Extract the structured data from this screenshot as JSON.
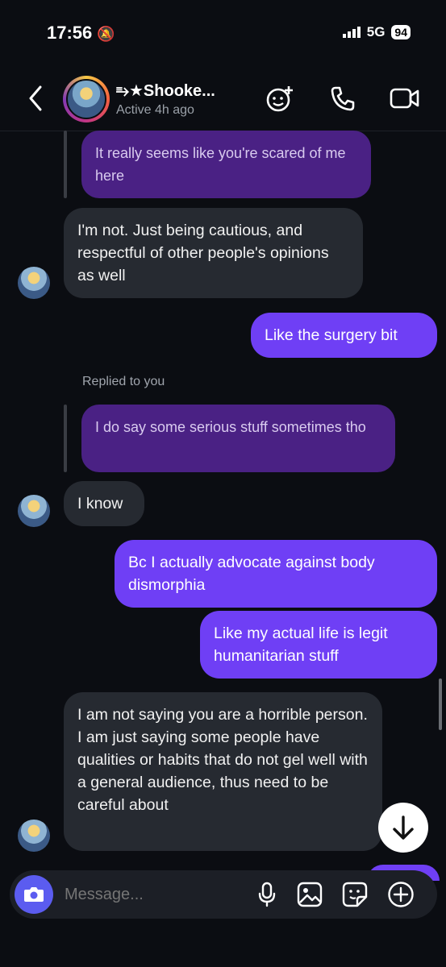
{
  "status_bar": {
    "time": "17:56",
    "network": "5G",
    "battery": "94"
  },
  "header": {
    "contact_name": "⥱★Shooke...",
    "active_status": "Active 4h ago"
  },
  "messages": {
    "m1_quoted": "It really seems like you're scared of me here",
    "m2_in": "I'm not. Just being cautious, and respectful of other people's opinions as well",
    "m3_out": "Like the surgery bit",
    "replied_label": "Replied to you",
    "m4_quoted": "I do say some serious stuff sometimes tho",
    "m5_in": "I know",
    "m6_out": "Bc I actually advocate against body dismorphia",
    "m7_out": "Like my actual life is legit humanitarian stuff",
    "m8_in": "I am not saying you are a horrible person. I am just saying some people have qualities or habits that do not gel well with a general audience, thus need to be careful about"
  },
  "composer": {
    "placeholder": "Message..."
  },
  "colors": {
    "outgoing": "#6f3ff5",
    "incoming": "#262a31",
    "quoted": "#4a2184",
    "background": "#0b0d12"
  }
}
